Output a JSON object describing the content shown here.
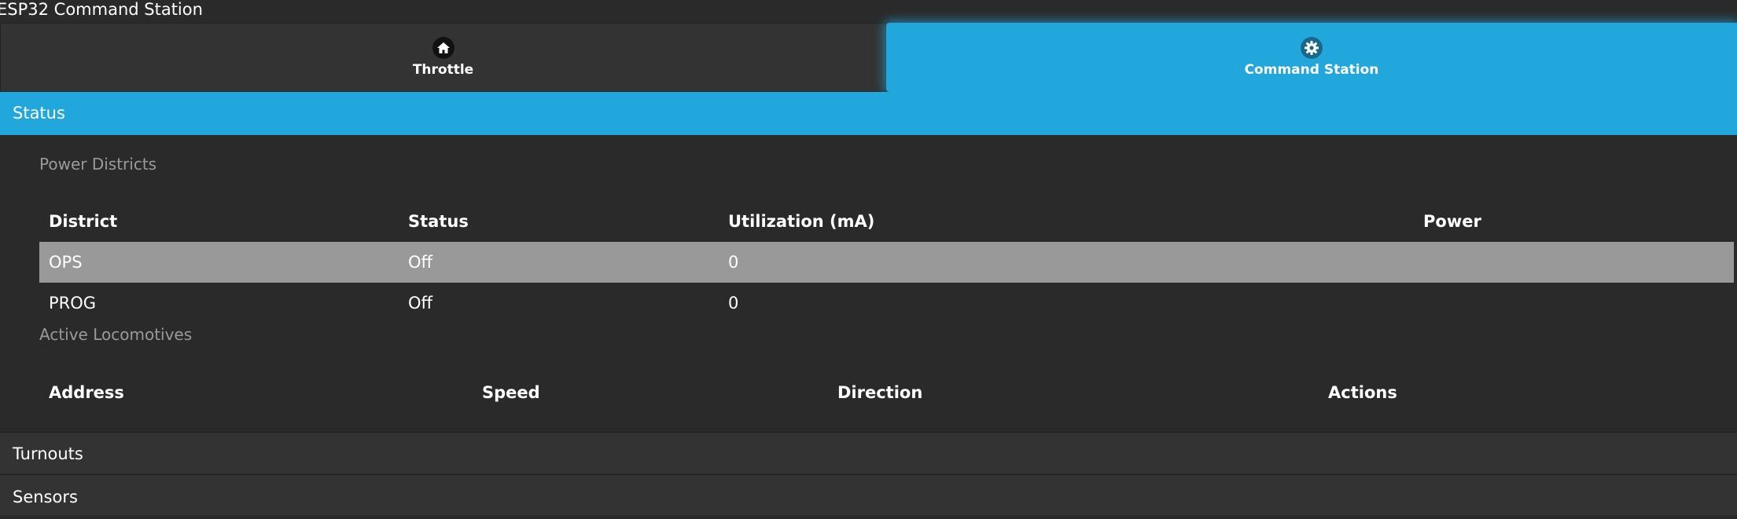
{
  "app": {
    "title": "ESP32 Command Station"
  },
  "nav": {
    "tabs": [
      {
        "label": "Throttle",
        "icon": "home-icon",
        "active": false
      },
      {
        "label": "Command Station",
        "icon": "gear-icon",
        "active": true
      }
    ]
  },
  "colors": {
    "accent": "#22a7dc",
    "background": "#2a2a2a",
    "panel": "#333333",
    "row_highlight": "#999999",
    "muted_text": "#9a9a9a"
  },
  "status_section": {
    "header": "Status",
    "power_districts": {
      "label": "Power Districts",
      "columns": [
        "District",
        "Status",
        "Utilization (mA)",
        "Power"
      ],
      "rows": [
        [
          "OPS",
          "Off",
          "0",
          ""
        ],
        [
          "PROG",
          "Off",
          "0",
          ""
        ]
      ]
    },
    "active_locomotives": {
      "label": "Active Locomotives",
      "columns": [
        "Address",
        "Speed",
        "Direction",
        "Actions"
      ],
      "rows": []
    }
  },
  "turnouts_section": {
    "header": "Turnouts"
  },
  "sensors_section": {
    "header": "Sensors"
  }
}
